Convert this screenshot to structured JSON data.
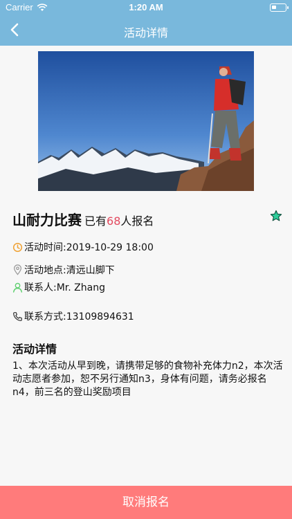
{
  "status": {
    "carrier": "Carrier",
    "time": "1:20 AM"
  },
  "nav": {
    "title": "活动详情"
  },
  "activity": {
    "title": "山耐力比赛",
    "signup_prefix": "已有",
    "signup_count": "68",
    "signup_suffix": "人报名",
    "time": "活动时间:2019-10-29 18:00",
    "location": "活动地点:清远山脚下",
    "contact": "联系人:Mr. Zhang",
    "phone": "联系方式:13109894631"
  },
  "details": {
    "heading": "活动详情",
    "text": "1、本次活动从早到晚，请携带足够的食物补充体力n2，本次活动志愿者参加，恕不另行通知n3，身体有问题，请务必报名n4，前三名的登山奖励项目"
  },
  "footer": {
    "cancel_label": "取消报名"
  },
  "colors": {
    "header": "#79b8dc",
    "accent": "#e34a5f",
    "button": "#ff7b7b",
    "star": "#2ecc9a"
  }
}
